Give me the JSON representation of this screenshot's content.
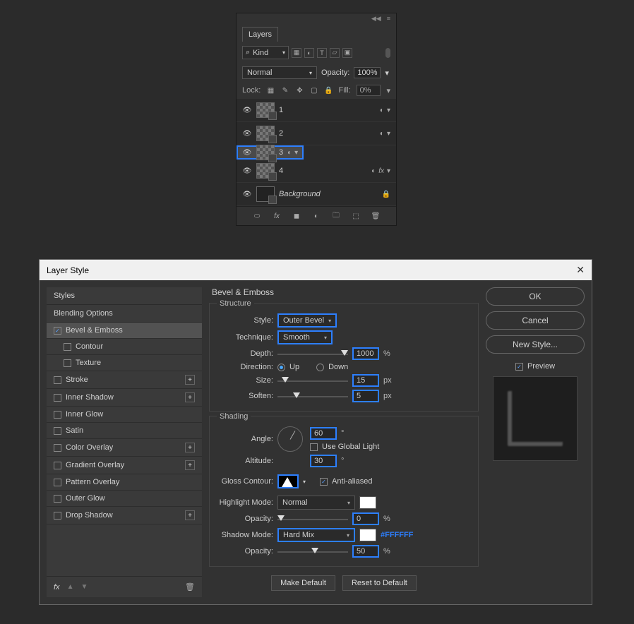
{
  "layers_panel": {
    "tab": "Layers",
    "filter_label": "Kind",
    "blend_mode": "Normal",
    "opacity_label": "Opacity:",
    "opacity_value": "100%",
    "lock_label": "Lock:",
    "fill_label": "Fill:",
    "fill_value": "0%",
    "layers": [
      {
        "name": "1",
        "selected": false,
        "fx": false,
        "bg": false
      },
      {
        "name": "2",
        "selected": false,
        "fx": false,
        "bg": false
      },
      {
        "name": "3",
        "selected": true,
        "fx": false,
        "bg": false
      },
      {
        "name": "4",
        "selected": false,
        "fx": true,
        "bg": false
      },
      {
        "name": "Background",
        "selected": false,
        "fx": false,
        "bg": true
      }
    ]
  },
  "dialog": {
    "title": "Layer Style",
    "sidebar": {
      "styles_header": "Styles",
      "blending_options": "Blending Options",
      "bevel_emboss": "Bevel & Emboss",
      "contour": "Contour",
      "texture": "Texture",
      "stroke": "Stroke",
      "inner_shadow": "Inner Shadow",
      "inner_glow": "Inner Glow",
      "satin": "Satin",
      "color_overlay": "Color Overlay",
      "gradient_overlay": "Gradient Overlay",
      "pattern_overlay": "Pattern Overlay",
      "outer_glow": "Outer Glow",
      "drop_shadow": "Drop Shadow"
    },
    "main": {
      "heading": "Bevel & Emboss",
      "structure_legend": "Structure",
      "style_label": "Style:",
      "style_value": "Outer Bevel",
      "technique_label": "Technique:",
      "technique_value": "Smooth",
      "depth_label": "Depth:",
      "depth_value": "1000",
      "depth_unit": "%",
      "direction_label": "Direction:",
      "direction_up": "Up",
      "direction_down": "Down",
      "size_label": "Size:",
      "size_value": "15",
      "size_unit": "px",
      "soften_label": "Soften:",
      "soften_value": "5",
      "soften_unit": "px",
      "shading_legend": "Shading",
      "angle_label": "Angle:",
      "angle_value": "60",
      "angle_unit": "°",
      "global_light_label": "Use Global Light",
      "altitude_label": "Altitude:",
      "altitude_value": "30",
      "altitude_unit": "°",
      "gloss_label": "Gloss Contour:",
      "antialias_label": "Anti-aliased",
      "highlight_mode_label": "Highlight Mode:",
      "highlight_mode_value": "Normal",
      "highlight_opacity_label": "Opacity:",
      "highlight_opacity_value": "0",
      "highlight_opacity_unit": "%",
      "shadow_mode_label": "Shadow Mode:",
      "shadow_mode_value": "Hard Mix",
      "shadow_color_hex": "#FFFFFF",
      "shadow_opacity_label": "Opacity:",
      "shadow_opacity_value": "50",
      "shadow_opacity_unit": "%",
      "make_default": "Make Default",
      "reset_default": "Reset to Default"
    },
    "right": {
      "ok": "OK",
      "cancel": "Cancel",
      "new_style": "New Style...",
      "preview": "Preview"
    }
  }
}
